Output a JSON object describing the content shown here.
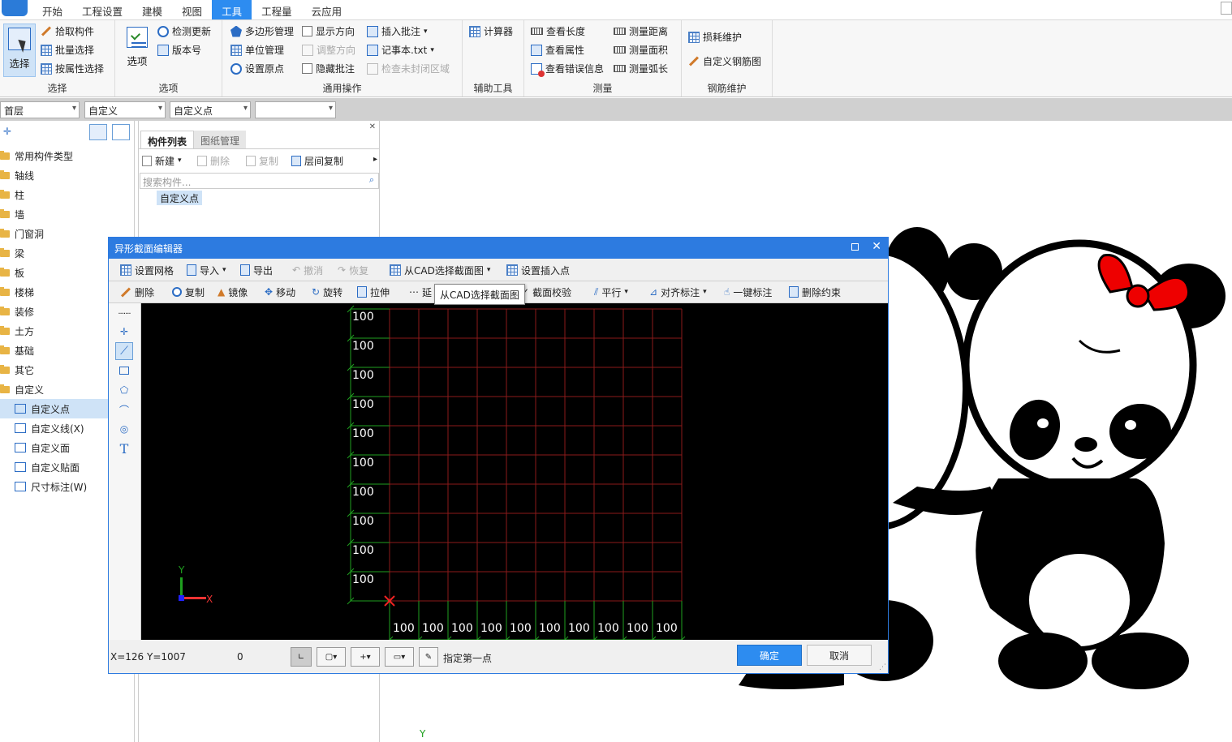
{
  "menu": [
    "开始",
    "工程设置",
    "建模",
    "视图",
    "工具",
    "工程量",
    "云应用"
  ],
  "menu_active": "工具",
  "ribbon": {
    "select_group": {
      "big": "选择",
      "items": [
        "拾取构件",
        "批量选择",
        "按属性选择"
      ],
      "title": "选择"
    },
    "option_group": {
      "big": "选项",
      "items": [
        "检测更新",
        "版本号"
      ],
      "title": "选项"
    },
    "general_group": {
      "col1": [
        "多边形管理",
        "单位管理",
        "设置原点"
      ],
      "col2": [
        "显示方向",
        "调整方向",
        "隐藏批注"
      ],
      "col3": [
        "插入批注",
        "记事本.txt",
        "检查未封闭区域"
      ],
      "title": "通用操作"
    },
    "aux_group": {
      "items": [
        "计算器"
      ],
      "title": "辅助工具"
    },
    "measure_group": {
      "col1": [
        "查看长度",
        "查看属性",
        "查看错误信息"
      ],
      "col2": [
        "测量距离",
        "测量面积",
        "测量弧长"
      ],
      "title": "测量"
    },
    "rebar_group": {
      "items": [
        "损耗维护",
        "自定义钢筋图"
      ],
      "title": "钢筋维护"
    }
  },
  "selectors": [
    "首层",
    "自定义",
    "自定义点",
    ""
  ],
  "tree": {
    "items": [
      "常用构件类型",
      "轴线",
      "柱",
      "墙",
      "门窗洞",
      "梁",
      "板",
      "楼梯",
      "装修",
      "土方",
      "基础",
      "其它",
      "自定义"
    ],
    "children": [
      "自定义点",
      "自定义线(X)",
      "自定义面",
      "自定义贴面",
      "尺寸标注(W)"
    ],
    "selected": "自定义点"
  },
  "component_panel": {
    "tabs": [
      "构件列表",
      "图纸管理"
    ],
    "toolbar": [
      "新建",
      "删除",
      "复制",
      "层间复制"
    ],
    "search_placeholder": "搜索构件...",
    "list": [
      "自定义点"
    ]
  },
  "dialog": {
    "title": "异形截面编辑器",
    "toolbar1": [
      "设置网格",
      "导入",
      "导出",
      "撤消",
      "恢复",
      "从CAD选择截面图",
      "设置插入点"
    ],
    "toolbar2": [
      "删除",
      "复制",
      "镜像",
      "移动",
      "旋转",
      "拉伸",
      "延",
      "截面校验",
      "平行",
      "对齐标注",
      "一键标注",
      "删除约束"
    ],
    "tooltip": "从CAD选择截面图",
    "grid_label": "100",
    "grid_rows": 10,
    "grid_cols": 10,
    "axis_x": "X",
    "axis_y": "Y",
    "coords": "X=126 Y=1007",
    "count": "0",
    "prompt": "指定第一点",
    "ok": "确定",
    "cancel": "取消"
  },
  "bottom_axis_y": "Y",
  "colors": {
    "accent": "#2d8cf0",
    "grid_red": "#8b1a1a",
    "grid_green": "#1fa01f",
    "canvas": "#000000"
  }
}
